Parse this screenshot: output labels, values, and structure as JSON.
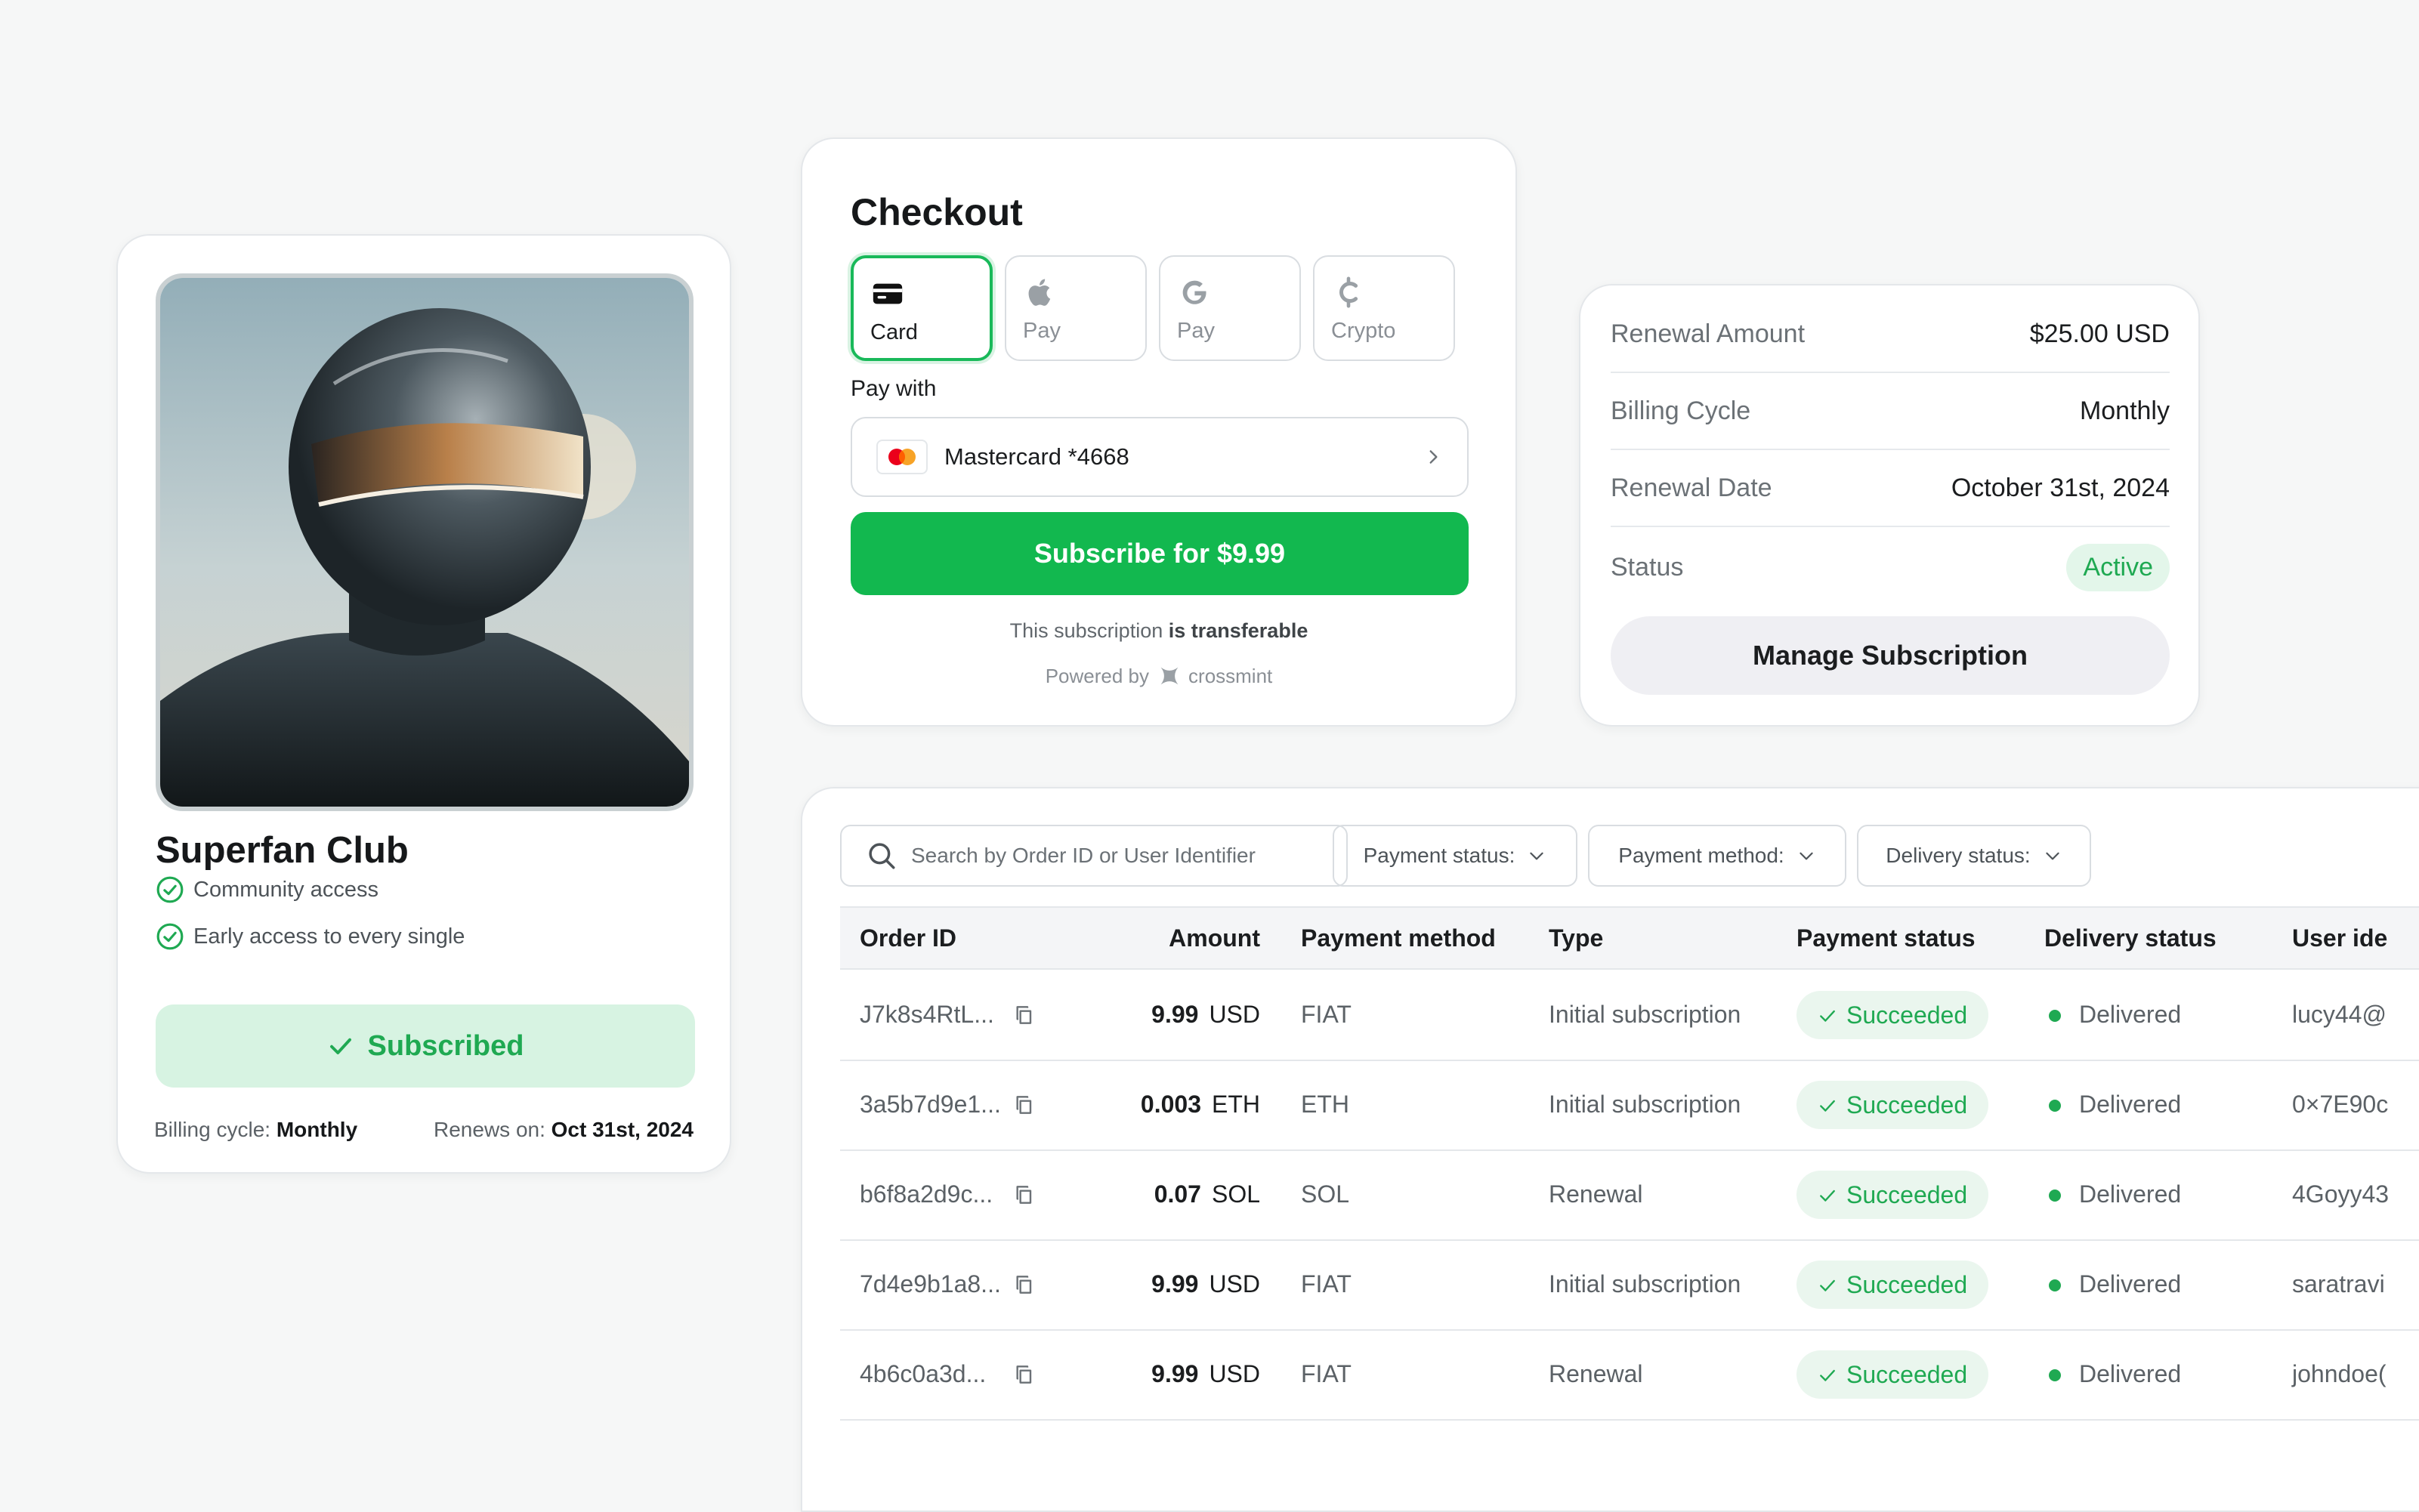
{
  "colors": {
    "brand_green": "#12b84f",
    "success_green": "#1fa952",
    "soft_green": "#d7f3e2"
  },
  "superfan": {
    "title": "Superfan Club",
    "features": [
      "Community access",
      "Early access to every single"
    ],
    "subscribed_label": "Subscribed",
    "billing_cycle_label": "Billing cycle:",
    "billing_cycle_value": "Monthly",
    "renews_label": "Renews on:",
    "renews_value": "Oct 31st, 2024"
  },
  "checkout": {
    "title": "Checkout",
    "methods": [
      {
        "label": "Card",
        "icon": "credit-card-icon",
        "active": true
      },
      {
        "label": "Pay",
        "icon": "apple-icon",
        "active": false
      },
      {
        "label": "Pay",
        "icon": "google-icon",
        "active": false
      },
      {
        "label": "Crypto",
        "icon": "crypto-icon",
        "active": false
      }
    ],
    "pay_with_label": "Pay with",
    "card_label": "Mastercard *4668",
    "subscribe_label": "Subscribe for $9.99",
    "transfer_prefix": "This subscription",
    "transfer_bold": "is transferable",
    "powered_by": "Powered by",
    "brand": "crossmint"
  },
  "renewal": {
    "rows": [
      {
        "key": "Renewal Amount",
        "value": "$25.00 USD"
      },
      {
        "key": "Billing Cycle",
        "value": "Monthly"
      },
      {
        "key": "Renewal Date",
        "value": "October 31st, 2024"
      }
    ],
    "status_label": "Status",
    "status_value": "Active",
    "manage_label": "Manage Subscription"
  },
  "orders": {
    "search_placeholder": "Search by Order ID or User Identifier",
    "filters": [
      "Payment status:",
      "Payment method:",
      "Delivery status:"
    ],
    "columns": [
      "Order ID",
      "Amount",
      "Payment method",
      "Type",
      "Payment status",
      "Delivery status",
      "User ide"
    ],
    "rows": [
      {
        "id": "J7k8s4RtL...",
        "amount": "9.99",
        "currency": "USD",
        "method": "FIAT",
        "type": "Initial subscription",
        "payment": "Succeeded",
        "delivery": "Delivered",
        "user": "lucy44@"
      },
      {
        "id": "3a5b7d9e1...",
        "amount": "0.003",
        "currency": "ETH",
        "method": "ETH",
        "type": "Initial subscription",
        "payment": "Succeeded",
        "delivery": "Delivered",
        "user": "0×7E90c"
      },
      {
        "id": "b6f8a2d9c...",
        "amount": "0.07",
        "currency": "SOL",
        "method": "SOL",
        "type": "Renewal",
        "payment": "Succeeded",
        "delivery": "Delivered",
        "user": "4Goyy43"
      },
      {
        "id": "7d4e9b1a8...",
        "amount": "9.99",
        "currency": "USD",
        "method": "FIAT",
        "type": "Initial subscription",
        "payment": "Succeeded",
        "delivery": "Delivered",
        "user": "saratravi"
      },
      {
        "id": "4b6c0a3d...",
        "amount": "9.99",
        "currency": "USD",
        "method": "FIAT",
        "type": "Renewal",
        "payment": "Succeeded",
        "delivery": "Delivered",
        "user": "johndoe("
      }
    ]
  }
}
